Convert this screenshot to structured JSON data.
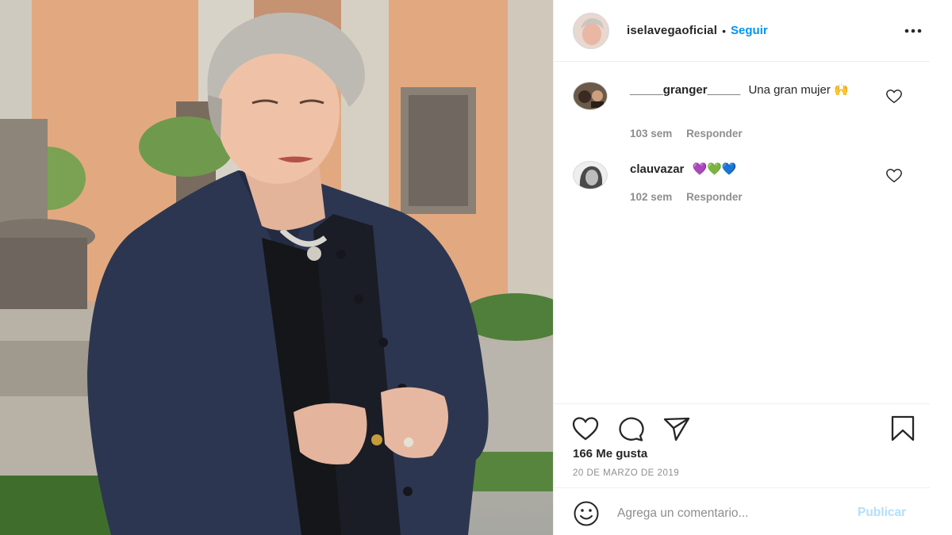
{
  "post": {
    "author": {
      "username": "iselavegaoficial",
      "follow_label": "Seguir",
      "separator": "•"
    },
    "comments": [
      {
        "username": "_____granger_____",
        "text": "Una gran mujer 🙌",
        "age": "103 sem",
        "reply_label": "Responder"
      },
      {
        "username": "clauvazar",
        "text": "💜💚💙",
        "age": "102 sem",
        "reply_label": "Responder"
      }
    ],
    "likes_text": "166 Me gusta",
    "date_text": "20 DE MARZO DE 2019",
    "add_comment": {
      "placeholder": "Agrega un comentario...",
      "publish_label": "Publicar"
    }
  },
  "icons": {
    "more": "more-options-icon",
    "like": "heart-icon",
    "comment": "comment-bubble-icon",
    "share": "paper-plane-icon",
    "save": "bookmark-icon",
    "emoji": "smiley-icon"
  },
  "colors": {
    "accent": "#0095f6",
    "publish_disabled": "#b2dffc",
    "muted": "#8e8e8e",
    "text": "#262626",
    "divider": "#efefef"
  }
}
